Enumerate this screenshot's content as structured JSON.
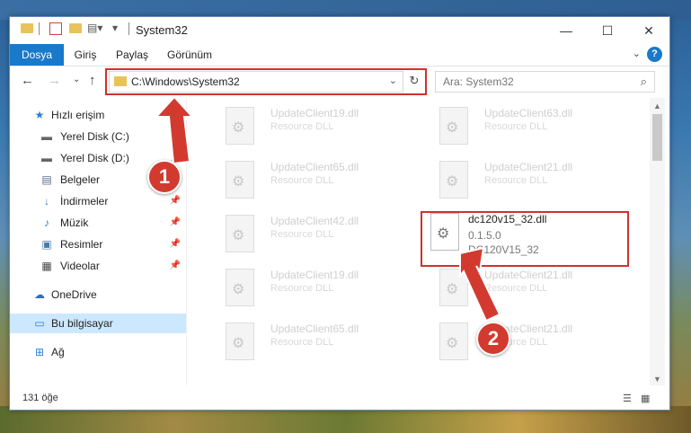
{
  "window": {
    "title": "System32"
  },
  "ribbon": {
    "tabs": [
      "Dosya",
      "Giriş",
      "Paylaş",
      "Görünüm"
    ],
    "help_label": "?"
  },
  "navigation": {
    "address_path": "C:\\Windows\\System32",
    "search_placeholder": "Ara: System32"
  },
  "sidebar": {
    "items": [
      {
        "label": "Hızlı erişim",
        "icon": "star-icon",
        "pinned": false
      },
      {
        "label": "Yerel Disk (C:)",
        "icon": "drive-icon",
        "pinned": true
      },
      {
        "label": "Yerel Disk (D:)",
        "icon": "drive-icon",
        "pinned": true
      },
      {
        "label": "Belgeler",
        "icon": "documents-icon",
        "pinned": true
      },
      {
        "label": "İndirmeler",
        "icon": "download-icon",
        "pinned": true
      },
      {
        "label": "Müzik",
        "icon": "music-icon",
        "pinned": true
      },
      {
        "label": "Resimler",
        "icon": "pictures-icon",
        "pinned": true
      },
      {
        "label": "Videolar",
        "icon": "video-icon",
        "pinned": true
      },
      {
        "label": "OneDrive",
        "icon": "cloud-icon",
        "pinned": false
      },
      {
        "label": "Bu bilgisayar",
        "icon": "computer-icon",
        "pinned": false
      },
      {
        "label": "Ağ",
        "icon": "network-icon",
        "pinned": false
      }
    ]
  },
  "files": [
    {
      "name": "UpdateClient19.dll",
      "type": "Resource DLL"
    },
    {
      "name": "UpdateClient63.dll",
      "type": "Resource DLL"
    },
    {
      "name": "UpdateClient65.dll",
      "type": "Resource DLL"
    },
    {
      "name": "UpdateClient21.dll",
      "type": "Resource DLL"
    },
    {
      "name": "UpdateClient42.dll",
      "type": "Resource DLL"
    },
    {
      "name": "dc120v15_32.dll",
      "version": "0.1.5.0",
      "type": "DC120V15_32"
    },
    {
      "name": "UpdateClient19.dll",
      "type": "Resource DLL"
    },
    {
      "name": "UpdateClient21.dll",
      "type": "Resource DLL"
    },
    {
      "name": "UpdateClient65.dll",
      "type": "Resource DLL"
    },
    {
      "name": "UpdateClient21.dll",
      "type": "Resource DLL"
    }
  ],
  "status": {
    "item_count": "131 öğe"
  },
  "callouts": [
    "1",
    "2"
  ],
  "colors": {
    "accent": "#1979ca",
    "highlight_red": "#d0312d",
    "selected_bg": "#cce8ff"
  }
}
